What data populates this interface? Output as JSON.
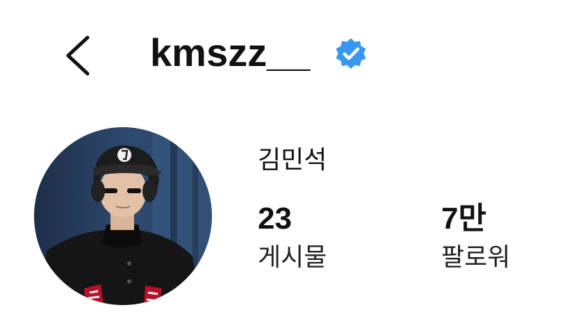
{
  "header": {
    "back_icon": "chevron-left-icon",
    "username": "kmszz__",
    "verified_icon": "verified-badge-icon",
    "verified_color": "#3897f0"
  },
  "profile": {
    "avatar_icon": "profile-photo",
    "display_name": "김민석",
    "stats": [
      {
        "value": "23",
        "label": "게시물"
      },
      {
        "value": "7만",
        "label": "팔로워"
      }
    ]
  }
}
